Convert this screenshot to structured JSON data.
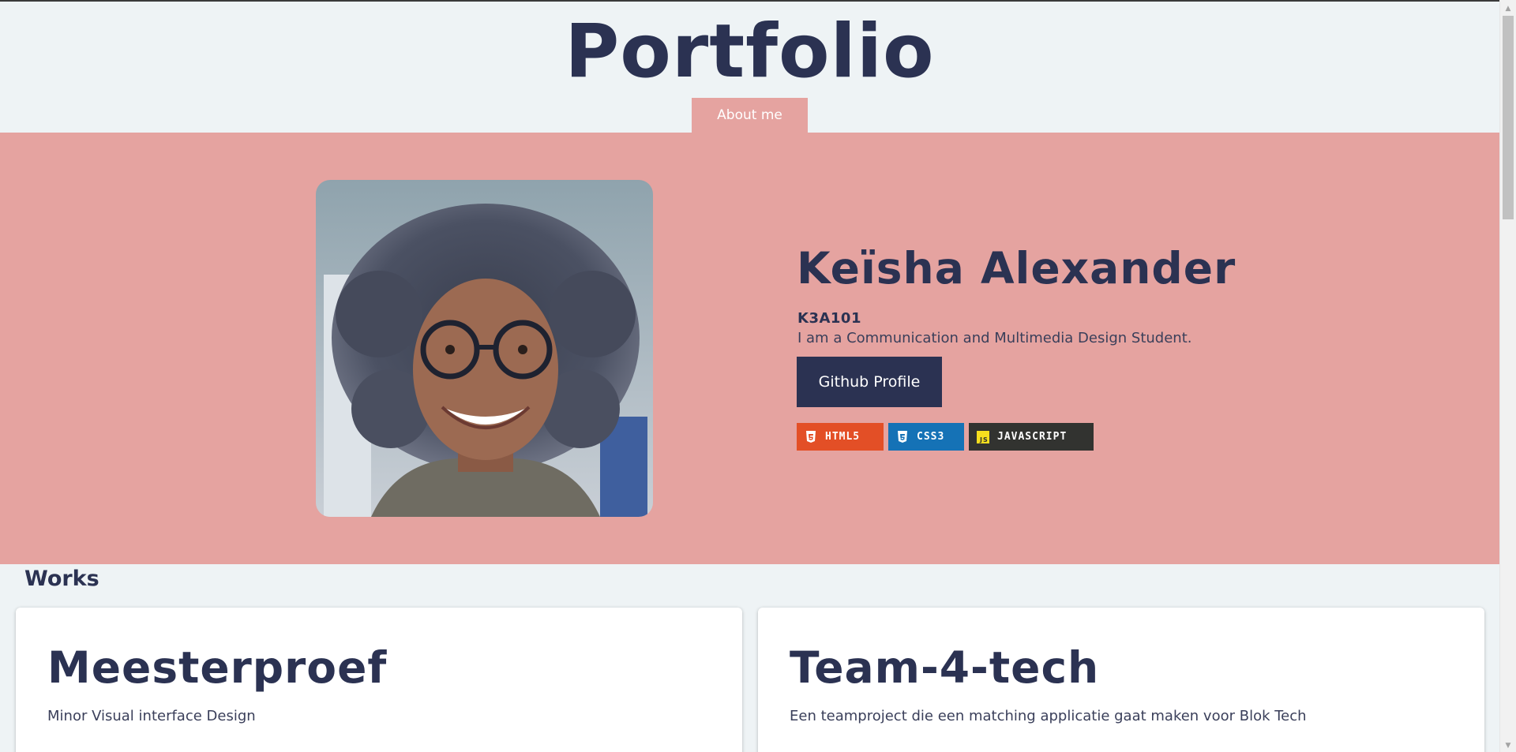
{
  "header": {
    "title": "Portfolio",
    "nav": [
      {
        "label": "About me"
      }
    ]
  },
  "hero": {
    "name": "Keïsha Alexander",
    "code": "K3A101",
    "description": "I am a Communication and Multimedia Design Student.",
    "github_label": "Github Profile",
    "badges": [
      {
        "label": "HTML5",
        "icon": "html5-icon",
        "color": "#e34f26"
      },
      {
        "label": "CSS3",
        "icon": "css3-icon",
        "color": "#1572b6"
      },
      {
        "label": "JAVASCRIPT",
        "icon": "javascript-icon",
        "color": "#323330"
      }
    ],
    "photo_icon": "profile-photo"
  },
  "works": {
    "heading": "Works",
    "cards": [
      {
        "title": "Meesterproef",
        "description": "Minor Visual interface Design"
      },
      {
        "title": "Team-4-tech",
        "description": "Een teamproject die een matching applicatie gaat maken voor Blok Tech"
      }
    ]
  },
  "colors": {
    "primary": "#2b3252",
    "accent": "#e5a3a0",
    "background": "#eef3f5"
  }
}
